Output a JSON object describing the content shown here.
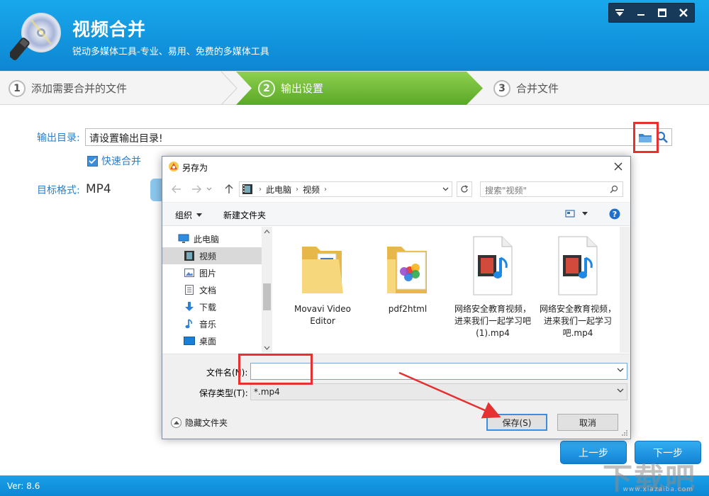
{
  "app": {
    "title": "视频合并",
    "subtitle": "锐动多媒体工具-专业、易用、免费的多媒体工具"
  },
  "steps": [
    {
      "num": "1",
      "label": "添加需要合并的文件"
    },
    {
      "num": "2",
      "label": "输出设置"
    },
    {
      "num": "3",
      "label": "合并文件"
    }
  ],
  "form": {
    "output_dir_label": "输出目录:",
    "output_dir_value": "请设置输出目录!",
    "fast_merge_label": "快速合并",
    "format_label": "目标格式:",
    "format_value": "MP4"
  },
  "buttons": {
    "prev": "上一步",
    "next": "下一步"
  },
  "status": {
    "version": "Ver: 8.6"
  },
  "watermark": {
    "text": "下载吧",
    "sub": "www.xiazaiba.com"
  },
  "dialog": {
    "title": "另存为",
    "breadcrumb": [
      "此电脑",
      "视频"
    ],
    "search_placeholder": "搜索\"视频\"",
    "toolbar": {
      "organize": "组织",
      "new_folder": "新建文件夹"
    },
    "nav_items": [
      {
        "label": "此电脑",
        "icon": "computer-icon"
      },
      {
        "label": "视频",
        "icon": "video-folder-icon"
      },
      {
        "label": "图片",
        "icon": "pictures-icon"
      },
      {
        "label": "文档",
        "icon": "documents-icon"
      },
      {
        "label": "下载",
        "icon": "download-icon"
      },
      {
        "label": "音乐",
        "icon": "music-icon"
      },
      {
        "label": "桌面",
        "icon": "desktop-icon"
      }
    ],
    "files": [
      {
        "name": "Movavi Video Editor",
        "type": "folder"
      },
      {
        "name": "pdf2html",
        "type": "folder"
      },
      {
        "name": "网络安全教育视频，进来我们一起学习吧(1).mp4",
        "type": "mp4"
      },
      {
        "name": "网络安全教育视频，进来我们一起学习吧.mp4",
        "type": "mp4"
      }
    ],
    "filename_label": "文件名(N):",
    "filename_value": "",
    "filetype_label": "保存类型(T):",
    "filetype_value": "*.mp4",
    "hide_folders": "隐藏文件夹",
    "save": "保存(S)",
    "cancel": "取消"
  },
  "colors": {
    "header_blue": "#0d86d2",
    "active_step_green": "#6cb733",
    "label_blue": "#2b7fc8",
    "annotation_red": "#e53131"
  }
}
